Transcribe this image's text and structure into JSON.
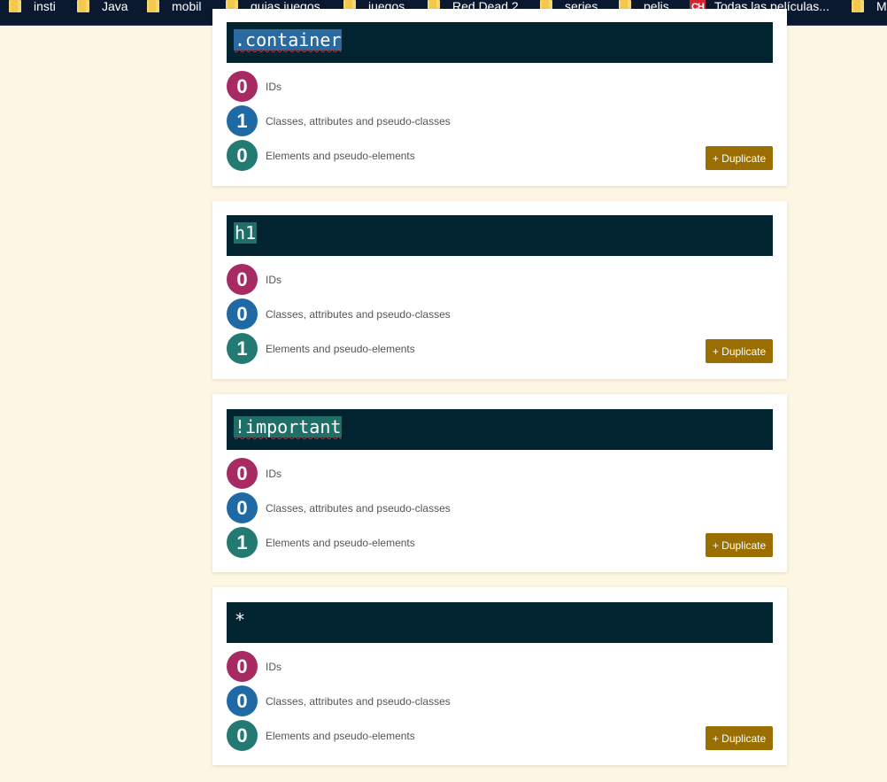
{
  "bookmarks": [
    {
      "label": "insti",
      "icon": "folder-icon"
    },
    {
      "label": "Java",
      "icon": "folder-icon"
    },
    {
      "label": "mobil",
      "icon": "folder-icon"
    },
    {
      "label": "guias juegos",
      "icon": "folder-icon"
    },
    {
      "label": "juegos",
      "icon": "folder-icon"
    },
    {
      "label": "Red Dead 2",
      "icon": "folder-icon"
    },
    {
      "label": "series",
      "icon": "folder-icon"
    },
    {
      "label": "pelis",
      "icon": "folder-icon"
    },
    {
      "label": "Todas las películas...",
      "icon": "ch-site-icon",
      "icon_text": "CH"
    },
    {
      "label": "M",
      "icon": "folder-icon"
    }
  ],
  "labels": {
    "ids": "IDs",
    "classes": "Classes, attributes and pseudo-classes",
    "elements": "Elements and pseudo-elements",
    "duplicate": "+ Duplicate"
  },
  "cards": [
    {
      "selector": ".container",
      "ids": "0",
      "classes": "1",
      "elements": "0"
    },
    {
      "selector": "h1",
      "ids": "0",
      "classes": "0",
      "elements": "1"
    },
    {
      "selector": "!important",
      "ids": "0",
      "classes": "0",
      "elements": "1"
    },
    {
      "selector": "*",
      "ids": "0",
      "classes": "0",
      "elements": "0"
    }
  ],
  "colors": {
    "page_background": "#fdf6e3",
    "selector_bar": "#022430",
    "ids_circle": "#a82a62",
    "classes_circle": "#1f6aa5",
    "elements_circle": "#227a72",
    "duplicate_button": "#9a6e00"
  }
}
